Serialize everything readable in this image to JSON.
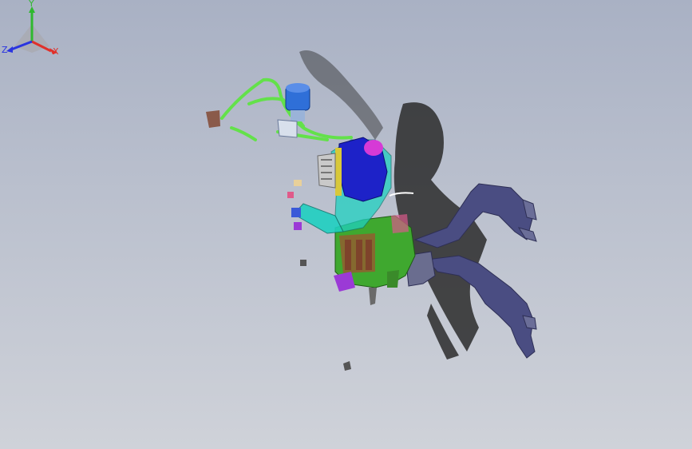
{
  "viewport": {
    "background_top": "#a9b1c4",
    "background_bottom": "#cfd2d9",
    "model": {
      "parts": [
        {
          "name": "pedal-bracket",
          "color": "#4a4d82"
        },
        {
          "name": "hvac-housing",
          "color": "#3fa82f"
        },
        {
          "name": "blower-motor",
          "color": "#1d22c8"
        },
        {
          "name": "duct-assembly",
          "color": "#1fd0c0"
        },
        {
          "name": "hose-tubes",
          "color": "#63e14a"
        },
        {
          "name": "reservoir",
          "color": "#2f6fd8"
        },
        {
          "name": "shadow",
          "color": "#2a2a2a"
        }
      ]
    }
  },
  "triad": {
    "x_label": "X",
    "y_label": "Y",
    "z_label": "Z",
    "x_color": "#e0302a",
    "y_color": "#2fb82f",
    "z_color": "#2a34e0"
  }
}
